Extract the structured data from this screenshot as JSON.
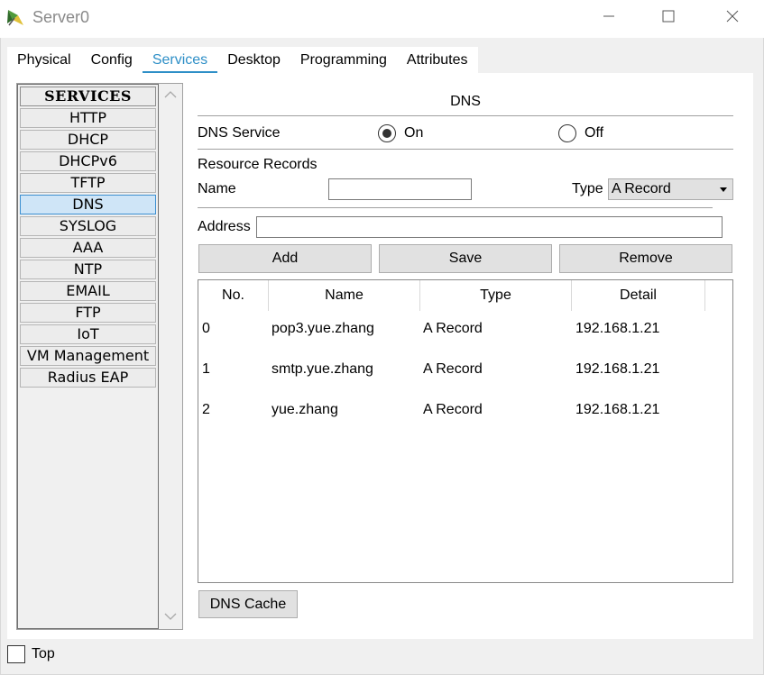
{
  "window": {
    "title": "Server0",
    "controls": {
      "minimize": "minimize-icon",
      "maximize": "maximize-icon",
      "close": "close-icon"
    }
  },
  "tabs": [
    {
      "label": "Physical"
    },
    {
      "label": "Config"
    },
    {
      "label": "Services",
      "active": true
    },
    {
      "label": "Desktop"
    },
    {
      "label": "Programming"
    },
    {
      "label": "Attributes"
    }
  ],
  "services": {
    "header": "SERVICES",
    "items": [
      "HTTP",
      "DHCP",
      "DHCPv6",
      "TFTP",
      "DNS",
      "SYSLOG",
      "AAA",
      "NTP",
      "EMAIL",
      "FTP",
      "IoT",
      "VM Management",
      "Radius EAP"
    ],
    "selected": "DNS"
  },
  "dns": {
    "title": "DNS",
    "service_label": "DNS Service",
    "on_label": "On",
    "off_label": "Off",
    "service_state": "On",
    "resource_records_label": "Resource Records",
    "name_label": "Name",
    "name_value": "",
    "type_label": "Type",
    "type_value": "A Record",
    "address_label": "Address",
    "address_value": "",
    "buttons": {
      "add": "Add",
      "save": "Save",
      "remove": "Remove",
      "cache": "DNS Cache"
    },
    "table": {
      "headers": {
        "no": "No.",
        "name": "Name",
        "type": "Type",
        "detail": "Detail"
      },
      "rows": [
        {
          "no": "0",
          "name": "pop3.yue.zhang",
          "type": "A Record",
          "detail": "192.168.1.21"
        },
        {
          "no": "1",
          "name": "smtp.yue.zhang",
          "type": "A Record",
          "detail": "192.168.1.21"
        },
        {
          "no": "2",
          "name": "yue.zhang",
          "type": "A Record",
          "detail": "192.168.1.21"
        }
      ]
    }
  },
  "footer": {
    "top_label": "Top",
    "top_checked": false
  },
  "colors": {
    "accent": "#2e8fc7",
    "selected_item": "#cfe5f7"
  }
}
